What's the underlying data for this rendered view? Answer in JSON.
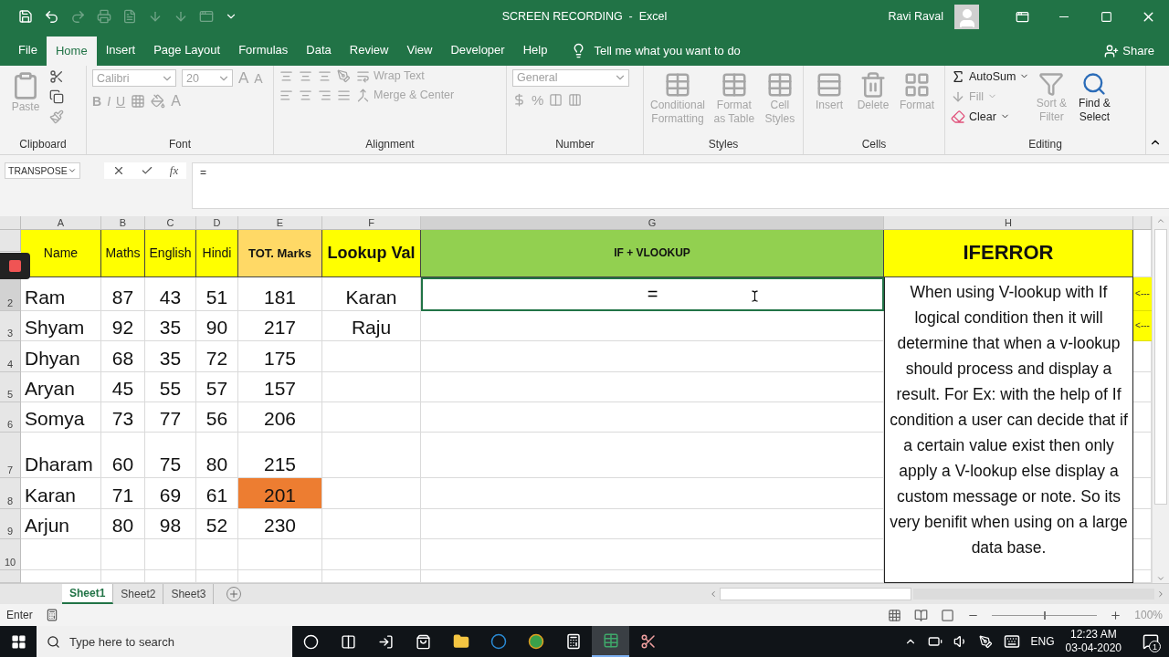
{
  "title_bar": {
    "title": "SCREEN RECORDING  -  Excel",
    "user": "Ravi Raval"
  },
  "menu_tabs": [
    {
      "label": "File",
      "selected": false
    },
    {
      "label": "Home",
      "selected": true
    },
    {
      "label": "Insert",
      "selected": false
    },
    {
      "label": "Page Layout",
      "selected": false
    },
    {
      "label": "Formulas",
      "selected": false
    },
    {
      "label": "Data",
      "selected": false
    },
    {
      "label": "Review",
      "selected": false
    },
    {
      "label": "View",
      "selected": false
    },
    {
      "label": "Developer",
      "selected": false
    },
    {
      "label": "Help",
      "selected": false
    }
  ],
  "tell_me": "Tell me what you want to do",
  "share": "Share",
  "ribbon": {
    "clipboard": {
      "paste": "Paste",
      "label": "Clipboard"
    },
    "font": {
      "name": "Calibri",
      "size": "20",
      "grow": "A",
      "shrink": "A",
      "styles": [
        "B",
        "I",
        "U"
      ],
      "color_letter": "A",
      "label": "Font"
    },
    "alignment": {
      "wrap": "Wrap Text",
      "merge": "Merge & Center",
      "label": "Alignment"
    },
    "number": {
      "format": "General",
      "percent": "%",
      "label": "Number"
    },
    "styles": {
      "buttons": [
        {
          "label": "Conditional Formatting",
          "disabled": true
        },
        {
          "label": "Format as Table",
          "disabled": true
        },
        {
          "label": "Cell Styles",
          "disabled": true
        }
      ],
      "label": "Styles"
    },
    "cells": {
      "buttons": [
        {
          "label": "Insert",
          "disabled": true
        },
        {
          "label": "Delete",
          "disabled": true
        },
        {
          "label": "Format",
          "disabled": true
        }
      ],
      "label": "Cells"
    },
    "editing": {
      "autosum": {
        "label": "AutoSum",
        "disabled": false
      },
      "fill": {
        "label": "Fill",
        "disabled": true
      },
      "clear": {
        "label": "Clear",
        "disabled": false
      },
      "sort": {
        "label": "Sort & Filter",
        "disabled": true
      },
      "find": {
        "label": "Find & Select",
        "disabled": false
      },
      "label": "Editing"
    }
  },
  "formula_bar": {
    "name_box": "TRANSPOSE",
    "fx": "fx",
    "formula": "="
  },
  "sheet": {
    "columns": [
      {
        "letter": "A",
        "selected": false
      },
      {
        "letter": "B",
        "selected": false
      },
      {
        "letter": "C",
        "selected": false
      },
      {
        "letter": "D",
        "selected": false
      },
      {
        "letter": "E",
        "selected": false
      },
      {
        "letter": "F",
        "selected": false
      },
      {
        "letter": "G",
        "selected": true
      },
      {
        "letter": "H",
        "selected": false
      }
    ],
    "header_row": [
      {
        "text": "Name",
        "color": "#ffff00"
      },
      {
        "text": "Maths",
        "color": "#ffff00"
      },
      {
        "text": "English",
        "color": "#ffff00"
      },
      {
        "text": "Hindi",
        "color": "#ffff00"
      },
      {
        "text": "TOT. Marks",
        "color": "#ffd966"
      },
      {
        "text": "Lookup Val",
        "color": "#ffff00"
      },
      {
        "text": "IF + VLOOKUP",
        "color": "#92d050"
      },
      {
        "text": "IFERROR",
        "color": "#ffff00"
      }
    ],
    "rows": [
      {
        "number": "2",
        "selected": true,
        "cells": [
          "Ram",
          "87",
          "43",
          "51",
          "181",
          "Karan"
        ],
        "total_highlight": false,
        "side_note": "<---"
      },
      {
        "number": "3",
        "selected": false,
        "cells": [
          "Shyam",
          "92",
          "35",
          "90",
          "217",
          "Raju"
        ],
        "total_highlight": false,
        "side_note": "<---"
      },
      {
        "number": "4",
        "selected": false,
        "cells": [
          "Dhyan",
          "68",
          "35",
          "72",
          "175"
        ],
        "total_highlight": false
      },
      {
        "number": "5",
        "selected": false,
        "cells": [
          "Aryan",
          "45",
          "55",
          "57",
          "157"
        ],
        "total_highlight": false
      },
      {
        "number": "6",
        "selected": false,
        "cells": [
          "Somya",
          "73",
          "77",
          "56",
          "206"
        ],
        "total_highlight": false
      },
      {
        "number": "7",
        "selected": false,
        "cells": [
          "Dharam",
          "60",
          "75",
          "80",
          "215"
        ],
        "total_highlight": false
      },
      {
        "number": "8",
        "selected": false,
        "cells": [
          "Karan",
          "71",
          "69",
          "61",
          "201"
        ],
        "total_highlight": true
      },
      {
        "number": "9",
        "selected": false,
        "cells": [
          "Arjun",
          "80",
          "98",
          "52",
          "230"
        ],
        "total_highlight": false
      },
      {
        "number": "10",
        "selected": false,
        "cells": [],
        "total_highlight": false
      }
    ],
    "active_cell": {
      "value": "="
    },
    "note_text": "When using V-lookup with If logical condition then it will determine that when a v-lookup should process and display a result. For Ex: with the help of If condition a user can decide that if a certain value exist then only apply a V-lookup else display a custom message or note. So its very benifit when using on a large data base."
  },
  "sheet_tabs": [
    {
      "label": "Sheet1",
      "selected": true
    },
    {
      "label": "Sheet2",
      "selected": false
    },
    {
      "label": "Sheet3",
      "selected": false
    }
  ],
  "status_bar": {
    "mode": "Enter",
    "zoom_slider": {
      "level": 0.5
    },
    "zoom": "100%"
  },
  "taskbar": {
    "search_placeholder": "Type here to search",
    "language": "ENG",
    "time": "12:23 AM",
    "date": "03-04-2020",
    "notifications": "1"
  }
}
